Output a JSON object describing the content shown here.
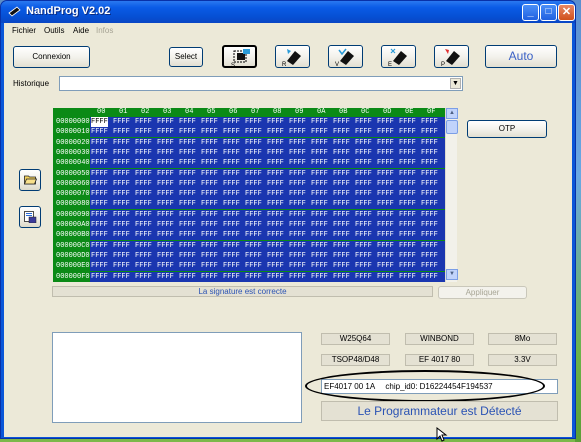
{
  "window": {
    "title": "NandProg V2.02"
  },
  "titlebar": {
    "min": "_",
    "max": "□",
    "close": "✕"
  },
  "menu": [
    {
      "label": "Fichier",
      "disabled": false
    },
    {
      "label": "Outils",
      "disabled": false
    },
    {
      "label": "Aide",
      "disabled": false
    },
    {
      "label": "Infos",
      "disabled": true
    }
  ],
  "toolbar": {
    "connexion": "Connexion",
    "select": "Select",
    "auto": "Auto",
    "icon_buttons": [
      {
        "name": "s-chip-icon",
        "letter": "S",
        "selected": true
      },
      {
        "name": "r-chip-icon",
        "letter": "R",
        "selected": false
      },
      {
        "name": "v-chip-icon",
        "letter": "V",
        "selected": false
      },
      {
        "name": "e-chip-icon",
        "letter": "E",
        "selected": false
      },
      {
        "name": "p-chip-icon",
        "letter": "P",
        "selected": false
      }
    ]
  },
  "historique": {
    "label": "Historique",
    "value": ""
  },
  "hex": {
    "columns": [
      "00",
      "01",
      "02",
      "03",
      "04",
      "05",
      "06",
      "07",
      "08",
      "09",
      "0A",
      "0B",
      "0C",
      "0D",
      "0E",
      "0F"
    ],
    "addresses": [
      "00000000",
      "00000010",
      "00000020",
      "00000030",
      "00000040",
      "00000050",
      "00000060",
      "00000070",
      "00000080",
      "00000090",
      "000000A0",
      "000000B0",
      "000000C0",
      "000000D0",
      "000000E0",
      "000000F0"
    ],
    "cell_value": "FFFF"
  },
  "otp": {
    "label": "OTP"
  },
  "signature": {
    "text": "La signature est correcte"
  },
  "appliquer": {
    "label": "Appliquer"
  },
  "chip": {
    "model": "W25Q64",
    "brand": "WINBOND",
    "size": "8Mo",
    "package": "TSOP48/D48",
    "id_code": "EF  4017  80",
    "voltage": "3.3V",
    "raw_id": "EF4017  00  1A",
    "chip_id": "chip_id0: D16224454F194537"
  },
  "status": {
    "detect": "Le Programmateur est Détecté"
  }
}
